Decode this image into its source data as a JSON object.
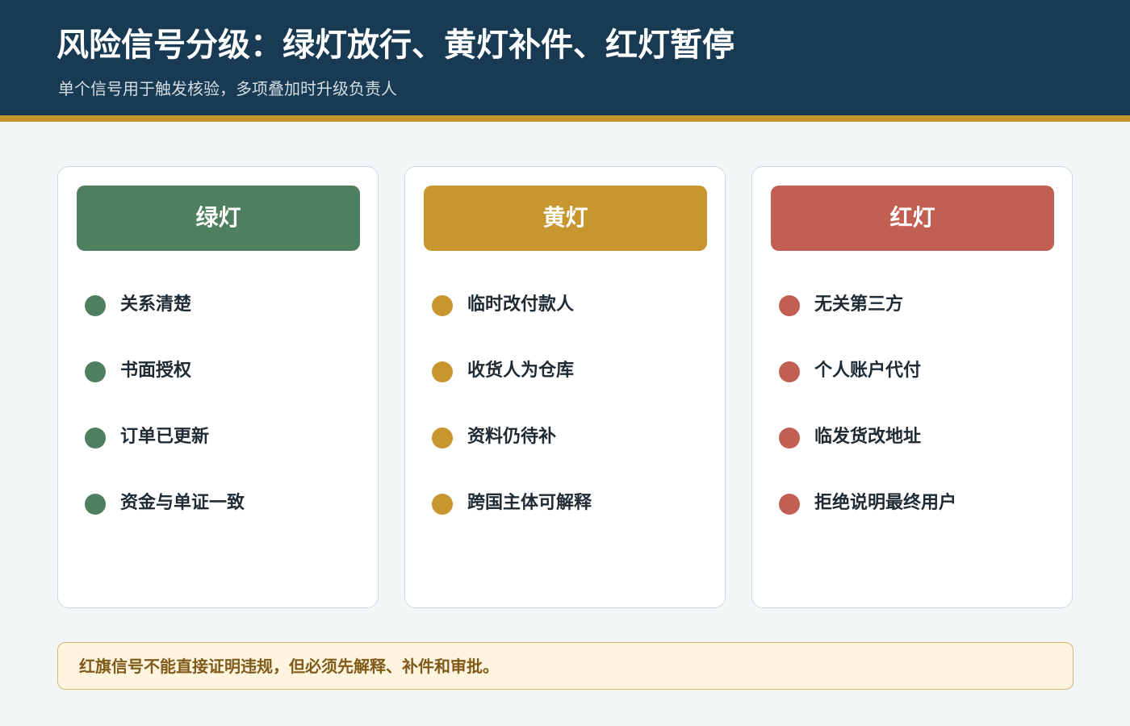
{
  "header": {
    "title": "风险信号分级：绿灯放行、黄灯补件、红灯暂停",
    "subtitle": "单个信号用于触发核验，多项叠加时升级负责人"
  },
  "colors": {
    "header_bg": "#183a52",
    "accent_bar": "#c8962f",
    "green": "#4e7f5f",
    "yellow": "#c8962f",
    "red": "#c25f53",
    "note_bg": "#fff5df"
  },
  "cards": {
    "green": {
      "label": "绿灯",
      "items": [
        "关系清楚",
        "书面授权",
        "订单已更新",
        "资金与单证一致"
      ]
    },
    "yellow": {
      "label": "黄灯",
      "items": [
        "临时改付款人",
        "收货人为仓库",
        "资料仍待补",
        "跨国主体可解释"
      ]
    },
    "red": {
      "label": "红灯",
      "items": [
        "无关第三方",
        "个人账户代付",
        "临发货改地址",
        "拒绝说明最终用户"
      ]
    }
  },
  "note": "红旗信号不能直接证明违规，但必须先解释、补件和审批。"
}
